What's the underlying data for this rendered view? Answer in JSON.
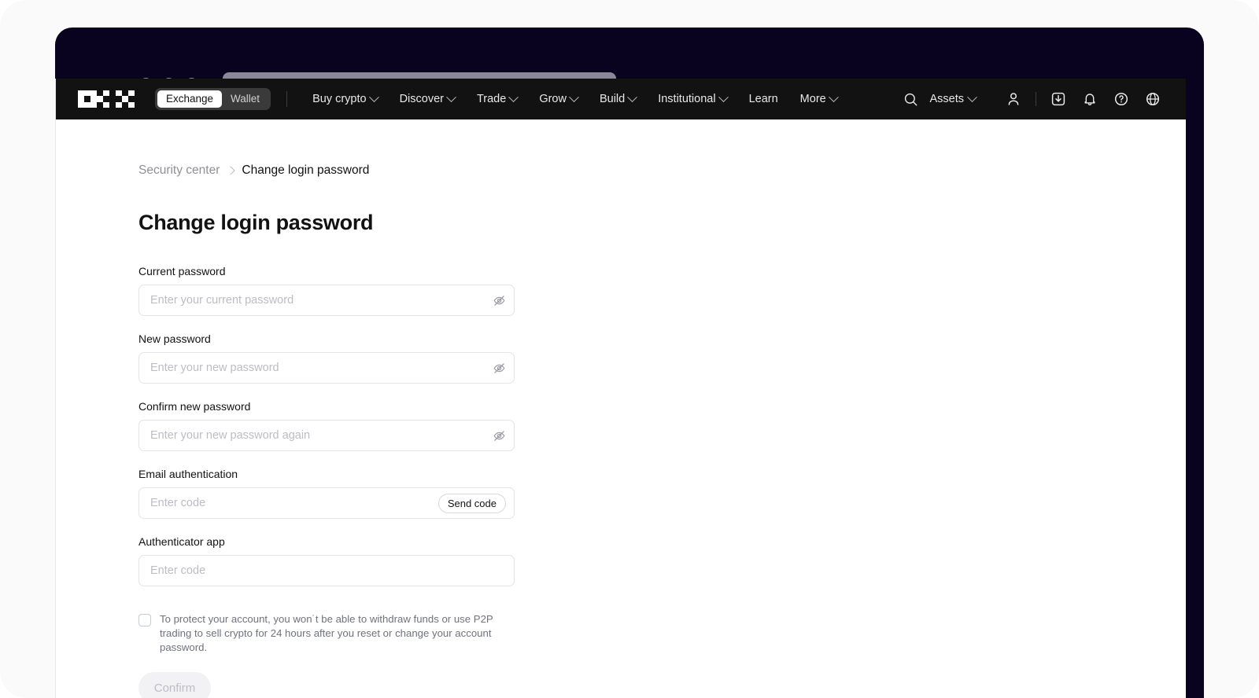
{
  "browser": {
    "traffic_lights": [
      "close",
      "minimize",
      "maximize"
    ],
    "url_bar_value": "",
    "chrome_color": "#0a0320",
    "dot_color": "#8b8799"
  },
  "nav": {
    "logo": "okx-logo",
    "toggle": {
      "options": [
        "Exchange",
        "Wallet"
      ],
      "selected": "Exchange"
    },
    "links": [
      {
        "label": "Buy crypto",
        "has_dropdown": true
      },
      {
        "label": "Discover",
        "has_dropdown": true
      },
      {
        "label": "Trade",
        "has_dropdown": true
      },
      {
        "label": "Grow",
        "has_dropdown": true
      },
      {
        "label": "Build",
        "has_dropdown": true
      },
      {
        "label": "Institutional",
        "has_dropdown": true
      },
      {
        "label": "Learn",
        "has_dropdown": false
      },
      {
        "label": "More",
        "has_dropdown": true
      }
    ],
    "right": {
      "search_icon": "search-icon",
      "assets_label": "Assets",
      "assets_has_dropdown": true,
      "profile_icon": "user-icon",
      "download_icon": "download-icon",
      "notification_icon": "bell-icon",
      "help_icon": "help-circle-icon",
      "language_icon": "globe-icon"
    },
    "background": "#121212"
  },
  "breadcrumb": {
    "parent": "Security center",
    "separator": "chevron-right-icon",
    "current": "Change login password"
  },
  "page": {
    "title": "Change login password"
  },
  "form": {
    "fields": [
      {
        "label": "Current password",
        "placeholder": "Enter your current password",
        "value": "",
        "type": "password",
        "trailing": "eye-off-icon"
      },
      {
        "label": "New password",
        "placeholder": "Enter your new password",
        "value": "",
        "type": "password",
        "trailing": "eye-off-icon"
      },
      {
        "label": "Confirm new password",
        "placeholder": "Enter your new password again",
        "value": "",
        "type": "password",
        "trailing": "eye-off-icon"
      },
      {
        "label": "Email authentication",
        "placeholder": "Enter code",
        "value": "",
        "type": "text",
        "trailing": "send-code-button"
      },
      {
        "label": "Authenticator app",
        "placeholder": "Enter code",
        "value": "",
        "type": "text",
        "trailing": "none"
      }
    ],
    "send_code_label": "Send code",
    "consent": {
      "checked": false,
      "text": "To protect your account, you won˙t be able to withdraw funds or use P2P trading to sell crypto for 24 hours after you reset or change your account password."
    },
    "confirm_label": "Confirm",
    "confirm_disabled": true
  },
  "colors": {
    "nav_bg": "#121212",
    "page_bg": "#ffffff",
    "text_primary": "#121212",
    "text_muted": "#8f8f96",
    "placeholder": "#bcbcc4",
    "border": "#e4e4e8",
    "disabled_button_bg": "#f2f2f4"
  }
}
